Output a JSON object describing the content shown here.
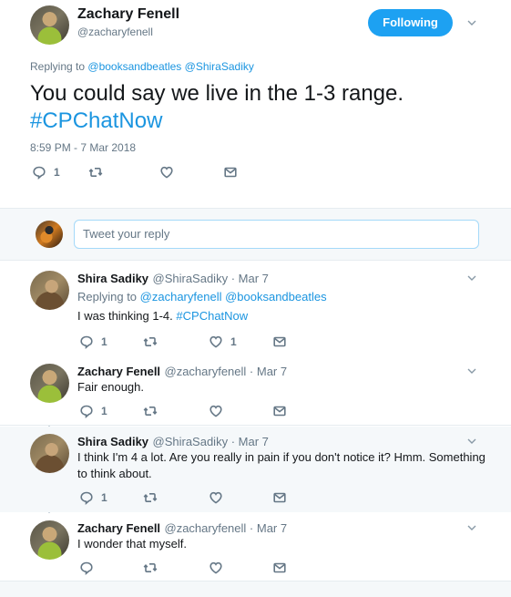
{
  "main": {
    "author_name": "Zachary Fenell",
    "author_handle": "@zacharyfenell",
    "follow_label": "Following",
    "replying_prefix": "Replying to",
    "replying_users": "@booksandbeatles @ShiraSadiky",
    "text": "You could say we live in the 1-3 range.",
    "hashtag": "#CPChatNow",
    "timestamp": "8:59 PM - 7 Mar 2018",
    "reply_count": "1",
    "retweet_count": "",
    "like_count": ""
  },
  "reply_box": {
    "placeholder": "Tweet your reply"
  },
  "replies": [
    {
      "name": "Shira Sadiky",
      "handle": "@ShiraSadiky",
      "date": "Mar 7",
      "replying_prefix": "Replying to",
      "replying_users": "@zacharyfenell @booksandbeatles",
      "text": "I was thinking 1-4.",
      "hashtag": "#CPChatNow",
      "reply_count": "1",
      "retweet_count": "",
      "like_count": "1"
    },
    {
      "name": "Zachary Fenell",
      "handle": "@zacharyfenell",
      "date": "Mar 7",
      "text": "Fair enough.",
      "reply_count": "1",
      "retweet_count": "",
      "like_count": ""
    },
    {
      "name": "Shira Sadiky",
      "handle": "@ShiraSadiky",
      "date": "Mar 7",
      "text_line1": "I think I'm 4 a lot. Are you really in pain if you don't notice it? Hmm. Something",
      "text_line2": "to think about.",
      "reply_count": "1",
      "retweet_count": "",
      "like_count": ""
    },
    {
      "name": "Zachary Fenell",
      "handle": "@zacharyfenell",
      "date": "Mar 7",
      "text": "I wonder that myself.",
      "reply_count": "",
      "retweet_count": "",
      "like_count": ""
    }
  ],
  "sep": " · ",
  "icons": [
    "reply-icon",
    "retweet-icon",
    "heart-icon",
    "dm-icon",
    "chevron-down-icon"
  ],
  "colors": {
    "accent": "#1da1f2",
    "link": "#1b95e0",
    "muted": "#657786"
  }
}
